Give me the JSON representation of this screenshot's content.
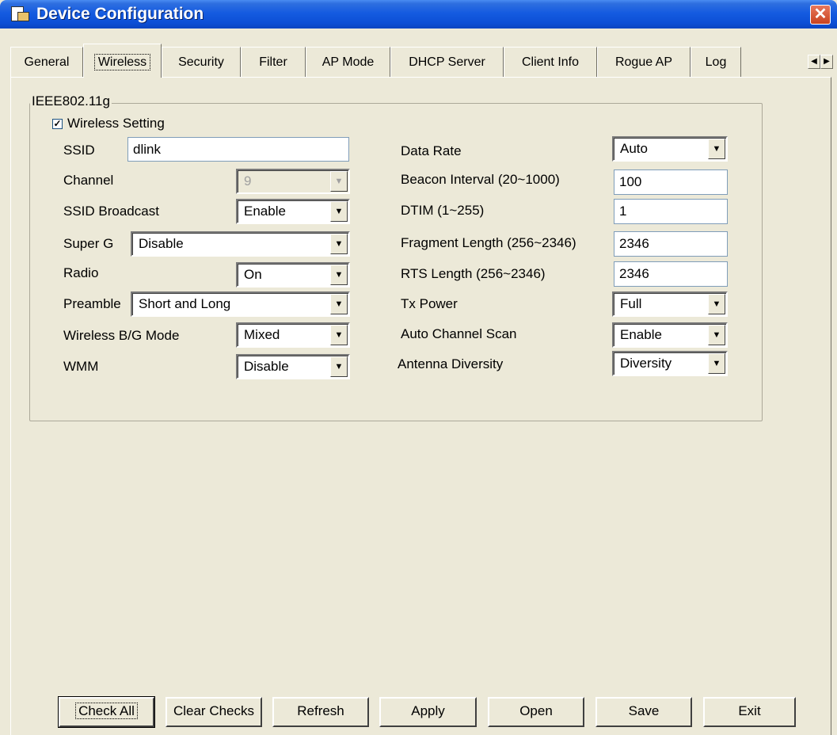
{
  "window": {
    "title": "Device Configuration",
    "close": "✕"
  },
  "tabs": [
    {
      "label": "General"
    },
    {
      "label": "Wireless"
    },
    {
      "label": "Security"
    },
    {
      "label": "Filter"
    },
    {
      "label": "AP Mode"
    },
    {
      "label": "DHCP Server"
    },
    {
      "label": "Client Info"
    },
    {
      "label": "Rogue AP"
    },
    {
      "label": "Log"
    }
  ],
  "active_tab": "Wireless",
  "group": {
    "legend": "IEEE802.11g",
    "wireless_setting": {
      "label": "Wireless Setting",
      "checked": true
    },
    "left": {
      "ssid": {
        "label": "SSID",
        "value": "dlink"
      },
      "channel": {
        "label": "Channel",
        "value": "9"
      },
      "ssid_broadcast": {
        "label": "SSID Broadcast",
        "value": "Enable"
      },
      "super_g": {
        "label": "Super G",
        "value": "Disable"
      },
      "radio": {
        "label": "Radio",
        "value": "On"
      },
      "preamble": {
        "label": "Preamble",
        "value": "Short and Long"
      },
      "bg_mode": {
        "label": "Wireless B/G Mode",
        "value": "Mixed"
      },
      "wmm": {
        "label": "WMM",
        "value": "Disable"
      }
    },
    "right": {
      "data_rate": {
        "label": "Data Rate",
        "value": "Auto"
      },
      "beacon": {
        "label": "Beacon Interval (20~1000)",
        "value": "100"
      },
      "dtim": {
        "label": "DTIM (1~255)",
        "value": "1"
      },
      "fragment": {
        "label": "Fragment Length (256~2346)",
        "value": "2346"
      },
      "rts": {
        "label": "RTS Length (256~2346)",
        "value": "2346"
      },
      "tx_power": {
        "label": "Tx Power",
        "value": "Full"
      },
      "auto_channel": {
        "label": "Auto Channel Scan",
        "value": "Enable"
      },
      "antenna": {
        "label": "Antenna Diversity",
        "value": "Diversity"
      }
    }
  },
  "buttons": {
    "check_all": "Check All",
    "clear_checks": "Clear Checks",
    "refresh": "Refresh",
    "apply": "Apply",
    "open": "Open",
    "save": "Save",
    "exit": "Exit"
  }
}
